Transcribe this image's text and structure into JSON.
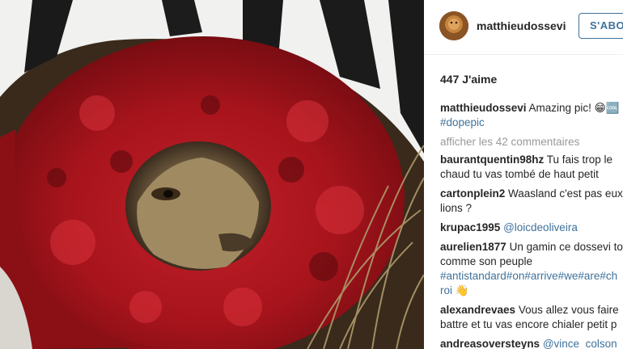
{
  "post": {
    "image_alt": "zebra carcass with lion cub peeking out",
    "username": "matthieudossevi",
    "follow_label": "S'ABONNER",
    "likes": "447 J'aime",
    "more_comments": "afficher les 42 commentaires"
  },
  "comments": [
    {
      "user": "matthieudossevi",
      "lines": [
        "Amazing pic! 😁🆒",
        "#dopepic"
      ]
    },
    {
      "user": "baurantquentin98hz",
      "lines": [
        "Tu fais trop le",
        "chaud tu vas tombé de haut petit"
      ]
    },
    {
      "user": "cartonplein2",
      "lines": [
        "Waasland c'est pas eux",
        "lions ?"
      ]
    },
    {
      "user": "krupac1995",
      "lines": [
        "@loicdeoliveira"
      ]
    },
    {
      "user": "aurelien1877",
      "lines": [
        "Un gamin ce dossevi to",
        "comme son peuple",
        "#antistandard#on#arrive#we#are#ch",
        "roi 👋"
      ]
    },
    {
      "user": "alexandrevaes",
      "lines": [
        "Vous allez vous faire",
        "battre et tu vas encore chialer petit p"
      ]
    },
    {
      "user": "andreasoversteyns",
      "lines": [
        "@vince_colson"
      ]
    }
  ],
  "colors": {
    "link": "#3f729b",
    "text": "#262626",
    "muted": "#999999"
  },
  "icons": [
    "follow-button",
    "avatar"
  ]
}
